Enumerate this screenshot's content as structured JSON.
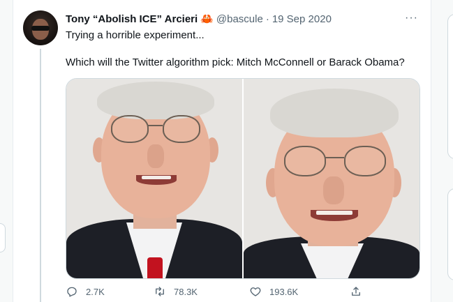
{
  "tweet": {
    "display_name": "Tony “Abolish ICE” Arcieri",
    "name_emoji": "🦀",
    "handle": "@bascule",
    "separator": "·",
    "date": "19 Sep 2020",
    "more_label": "···",
    "text_line1": "Trying a horrible experiment...",
    "text_line2": "Which will the Twitter algorithm pick: Mitch McConnell or Barack Obama?"
  },
  "media": {
    "images": [
      {
        "name": "photo-left",
        "subject": "man in suit with red tie, smiling, glasses"
      },
      {
        "name": "photo-right",
        "subject": "man in suit, smiling, glasses, close crop"
      }
    ]
  },
  "actions": {
    "reply_count": "2.7K",
    "retweet_count": "78.3K",
    "like_count": "193.6K",
    "icons": [
      "reply-icon",
      "retweet-icon",
      "like-icon",
      "share-icon"
    ]
  },
  "colors": {
    "text_primary": "#0f1419",
    "text_secondary": "#536471",
    "border": "#cfd9de",
    "tie_red": "#c2121f"
  }
}
